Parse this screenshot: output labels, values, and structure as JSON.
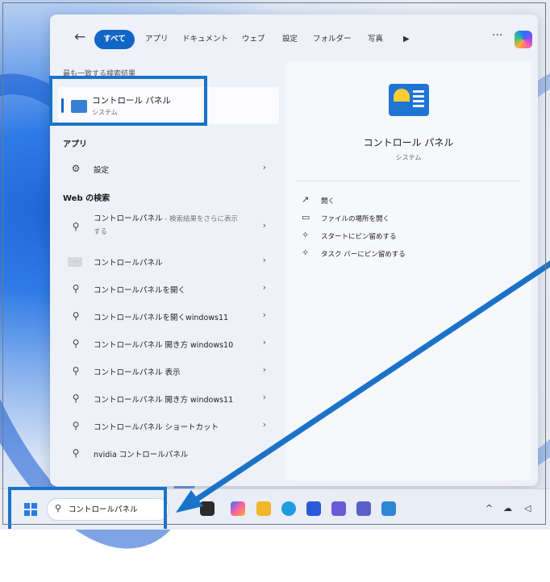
{
  "tabs": [
    "すべて",
    "アプリ",
    "ドキュメント",
    "ウェブ",
    "設定",
    "フォルダー",
    "写真"
  ],
  "best_match_header": "最も一致する検索結果",
  "best_match": {
    "title": "コントロール パネル",
    "subtitle": "システム"
  },
  "apps_header": "アプリ",
  "settings_item": "設定",
  "web_header": "Web の検索",
  "web_first": {
    "query": "コントロールパネル",
    "hint": " - 検索結果をさらに表示する"
  },
  "web_items": [
    "コントロールパネル",
    "コントロールパネルを開く",
    "コントロールパネルを開くwindows11",
    "コントロールパネル 開き方 windows10",
    "コントロールパネル 表示",
    "コントロールパネル 開き方 windows11",
    "コントロールパネル ショートカット",
    "nvidia コントロールパネル"
  ],
  "detail": {
    "title": "コントロール パネル",
    "subtitle": "システム",
    "actions": [
      "開く",
      "ファイルの場所を開く",
      "スタートにピン留めする",
      "タスク バーにピン留めする"
    ]
  },
  "taskbar": {
    "search_value": "コントロールパネル"
  },
  "colors": {
    "accent": "#1166c6",
    "highlight": "#1a73c9"
  },
  "icons": [
    "back-arrow-icon",
    "more-icon",
    "copilot-icon",
    "control-panel-icon",
    "gear-icon",
    "search-icon",
    "open-icon",
    "folder-icon",
    "pin-icon",
    "windows-logo-icon"
  ]
}
